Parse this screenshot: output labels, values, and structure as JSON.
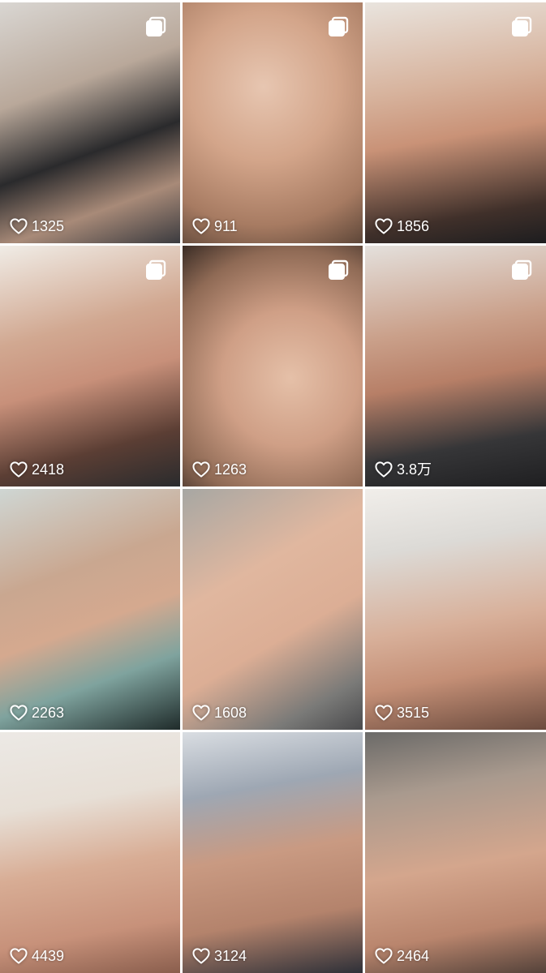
{
  "feed": {
    "posts": [
      {
        "likes": "1325",
        "multi_image": true
      },
      {
        "likes": "911",
        "multi_image": true
      },
      {
        "likes": "1856",
        "multi_image": true
      },
      {
        "likes": "2418",
        "multi_image": true
      },
      {
        "likes": "1263",
        "multi_image": true
      },
      {
        "likes": "3.8万",
        "multi_image": true
      },
      {
        "likes": "2263",
        "multi_image": false
      },
      {
        "likes": "1608",
        "multi_image": false
      },
      {
        "likes": "3515",
        "multi_image": false
      },
      {
        "likes": "4439",
        "multi_image": false
      },
      {
        "likes": "3124",
        "multi_image": false
      },
      {
        "likes": "2464",
        "multi_image": false
      }
    ]
  },
  "icons": {
    "like": "heart-outline-icon",
    "multi_image": "stacked-images-icon"
  },
  "colors": {
    "overlay_text": "#ffffff",
    "background": "#ffffff"
  }
}
